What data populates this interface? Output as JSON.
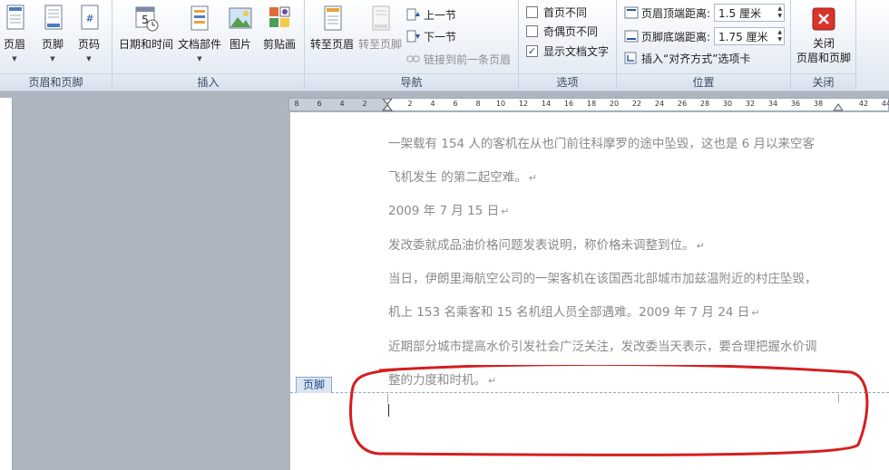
{
  "ribbon": {
    "header_footer_group": {
      "label": "页眉和页脚",
      "header_btn": "页眉",
      "footer_btn": "页脚",
      "page_number_btn": "页码"
    },
    "insert_group": {
      "label": "插入",
      "datetime_btn": "日期和时间",
      "quickparts_btn": "文档部件",
      "picture_btn": "图片",
      "clipart_btn": "剪贴画"
    },
    "nav_group": {
      "label": "导航",
      "goto_header_btn": "转至页眉",
      "goto_footer_btn": "转至页脚",
      "prev_btn": "上一节",
      "next_btn": "下一节",
      "link_prev_btn": "链接到前一条页眉"
    },
    "options_group": {
      "label": "选项",
      "diff_first": {
        "label": "首页不同",
        "checked": false
      },
      "diff_odd_even": {
        "label": "奇偶页不同",
        "checked": false
      },
      "show_doc_text": {
        "label": "显示文档文字",
        "checked": true
      }
    },
    "position_group": {
      "label": "位置",
      "header_top_label": "页眉顶端距离:",
      "header_top_value": "1.5 厘米",
      "footer_bottom_label": "页脚底端距离:",
      "footer_bottom_value": "1.75 厘米",
      "insert_align_tab": "插入“对齐方式”选项卡"
    },
    "close_group": {
      "label": "关闭",
      "close_line1": "关闭",
      "close_line2": "页眉和页脚"
    }
  },
  "ruler": {
    "ticks": [
      "8",
      "6",
      "4",
      "2",
      "",
      "2",
      "4",
      "6",
      "8",
      "10",
      "12",
      "14",
      "16",
      "18",
      "20",
      "22",
      "24",
      "26",
      "28",
      "30",
      "32",
      "34",
      "36",
      "38",
      "",
      "42",
      "44"
    ]
  },
  "document": {
    "paragraphs": [
      "一架载有 154 人的客机在从也门前往科摩罗的途中坠毁，这也是 6 月以来空客",
      "飞机发生  的第二起空难。",
      "2009 年 7 月 15 日",
      "发改委就成品油价格问题发表说明，称价格未调整到位。",
      "当日，伊朗里海航空公司的一架客机在该国西北部城市加兹温附近的村庄坠毁，",
      "机上 153 名乘客和 15 名机组人员全部遇难。2009 年 7 月 24 日",
      "近期部分城市提高水价引发社会广泛关注，发改委当天表示，要合理把握水价调",
      "整的力度和时机。"
    ],
    "footer_tab": "页脚"
  },
  "colors": {
    "annotation": "#d41f1f",
    "footer_border": "#8fa6c7",
    "body_text": "#8a8a8a"
  }
}
